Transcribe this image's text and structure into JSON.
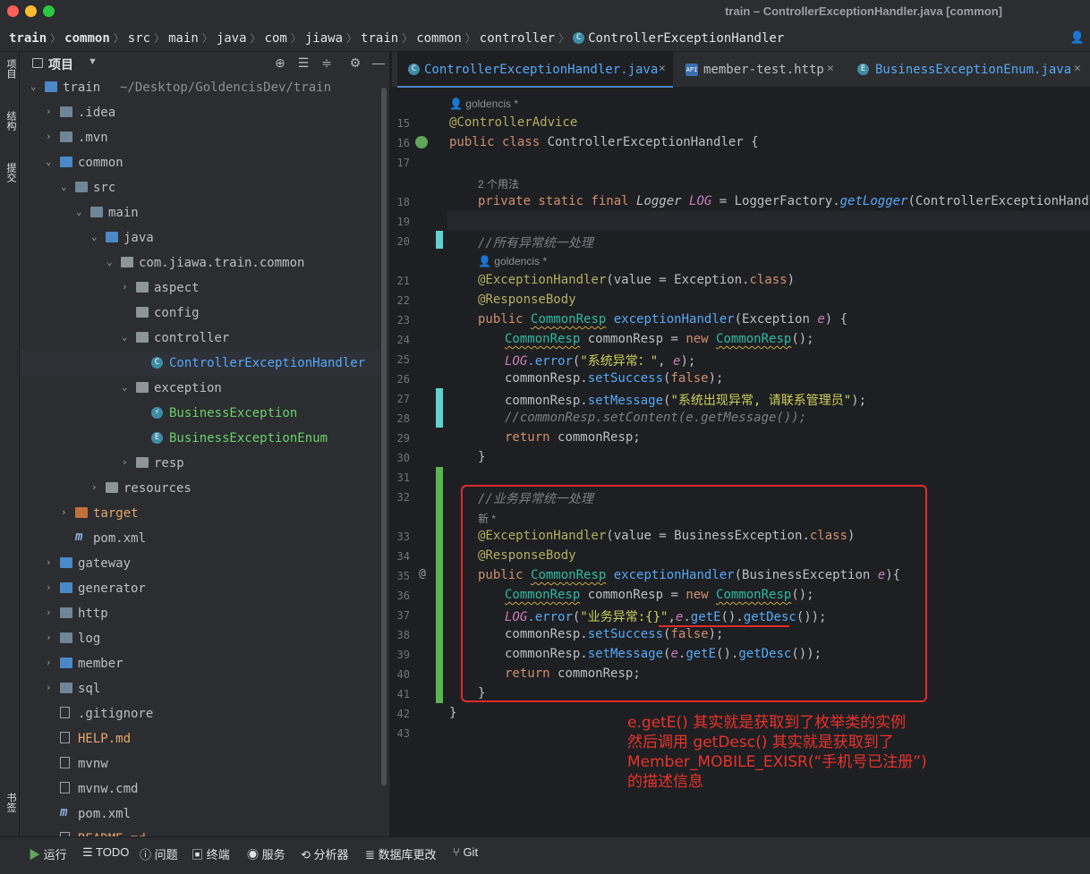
{
  "window": {
    "title": "train – ControllerExceptionHandler.java [common]"
  },
  "breadcrumbs": [
    "train",
    "common",
    "src",
    "main",
    "java",
    "com",
    "jiawa",
    "train",
    "common",
    "controller",
    "ControllerExceptionHandler"
  ],
  "left_tools": {
    "project": "项目",
    "structure": "结构",
    "commit": "提交",
    "bookmarks": "书签"
  },
  "project_panel": {
    "title": "项目",
    "root": "train",
    "root_path": "~/Desktop/GoldencisDev/train",
    "items": [
      {
        "label": ".idea",
        "indent": 1,
        "arrow": "right",
        "icon": "folder"
      },
      {
        "label": ".mvn",
        "indent": 1,
        "arrow": "right",
        "icon": "folder"
      },
      {
        "label": "common",
        "indent": 1,
        "arrow": "down",
        "icon": "module-folder"
      },
      {
        "label": "src",
        "indent": 2,
        "arrow": "down",
        "icon": "folder"
      },
      {
        "label": "main",
        "indent": 3,
        "arrow": "down",
        "icon": "folder"
      },
      {
        "label": "java",
        "indent": 4,
        "arrow": "down",
        "icon": "source-folder"
      },
      {
        "label": "com.jiawa.train.common",
        "indent": 5,
        "arrow": "down",
        "icon": "package"
      },
      {
        "label": "aspect",
        "indent": 6,
        "arrow": "right",
        "icon": "package"
      },
      {
        "label": "config",
        "indent": 6,
        "arrow": "none",
        "icon": "package"
      },
      {
        "label": "controller",
        "indent": 6,
        "arrow": "down",
        "icon": "package"
      },
      {
        "label": "ControllerExceptionHandler",
        "indent": 7,
        "arrow": "none",
        "icon": "class"
      },
      {
        "label": "exception",
        "indent": 6,
        "arrow": "down",
        "icon": "package"
      },
      {
        "label": "BusinessException",
        "indent": 7,
        "arrow": "none",
        "icon": "exception-class"
      },
      {
        "label": "BusinessExceptionEnum",
        "indent": 7,
        "arrow": "none",
        "icon": "enum"
      },
      {
        "label": "resp",
        "indent": 6,
        "arrow": "right",
        "icon": "package"
      },
      {
        "label": "resources",
        "indent": 4,
        "arrow": "right",
        "icon": "resources-folder"
      },
      {
        "label": "target",
        "indent": 2,
        "arrow": "right",
        "icon": "excluded-folder"
      },
      {
        "label": "pom.xml",
        "indent": 2,
        "arrow": "none",
        "icon": "maven"
      },
      {
        "label": "gateway",
        "indent": 1,
        "arrow": "right",
        "icon": "module-folder"
      },
      {
        "label": "generator",
        "indent": 1,
        "arrow": "right",
        "icon": "module-folder"
      },
      {
        "label": "http",
        "indent": 1,
        "arrow": "right",
        "icon": "folder"
      },
      {
        "label": "log",
        "indent": 1,
        "arrow": "right",
        "icon": "folder"
      },
      {
        "label": "member",
        "indent": 1,
        "arrow": "right",
        "icon": "module-folder"
      },
      {
        "label": "sql",
        "indent": 1,
        "arrow": "right",
        "icon": "folder"
      },
      {
        "label": ".gitignore",
        "indent": 1,
        "arrow": "none",
        "icon": "file"
      },
      {
        "label": "HELP.md",
        "indent": 1,
        "arrow": "none",
        "icon": "md"
      },
      {
        "label": "mvnw",
        "indent": 1,
        "arrow": "none",
        "icon": "file"
      },
      {
        "label": "mvnw.cmd",
        "indent": 1,
        "arrow": "none",
        "icon": "file"
      },
      {
        "label": "pom.xml",
        "indent": 1,
        "arrow": "none",
        "icon": "maven"
      },
      {
        "label": "README.md",
        "indent": 1,
        "arrow": "none",
        "icon": "md"
      }
    ]
  },
  "tabs": [
    {
      "label": "ControllerExceptionHandler.java",
      "active": true
    },
    {
      "label": "member-test.http",
      "active": false
    },
    {
      "label": "BusinessExceptionEnum.java",
      "active": false
    }
  ],
  "editor": {
    "author_hint_1": "goldencis *",
    "usages_hint": "2 个用法",
    "author_hint_2": "goldencis *",
    "new_hint": "新 *",
    "line_numbers": [
      "15",
      "16",
      "17",
      "18",
      "19",
      "20",
      "21",
      "22",
      "23",
      "24",
      "25",
      "26",
      "27",
      "28",
      "29",
      "30",
      "31",
      "32",
      "33",
      "34",
      "35",
      "36",
      "37",
      "38",
      "39",
      "40",
      "41",
      "42",
      "43"
    ],
    "code": {
      "l15": "@ControllerAdvice",
      "l16_kw": "public class ",
      "l16_name": "ControllerExceptionHandler {",
      "l18_kw": "private static final ",
      "l18_type": "Logger",
      "l18_var": "LOG",
      "l18_rest": " = LoggerFactory.",
      "l18_fn": "getLogger",
      "l18_arg": "(ControllerExceptionHandler.cla",
      "l20": "//所有异常统一处理",
      "l21_ann": "@ExceptionHandler",
      "l21_rest": "(value = Exception.",
      "l21_kw": "class",
      "l22": "@ResponseBody",
      "l23_kw": "public ",
      "l23_type": "CommonResp",
      "l23_fn": " exceptionHandler",
      "l23_args": "(Exception ",
      "l23_e": "e",
      "l23_end": ") {",
      "l24_type": "CommonResp",
      "l24_mid": " commonResp = ",
      "l24_kw": "new ",
      "l24_type2": "CommonResp",
      "l24_end": "();",
      "l25_log": "LOG",
      "l25_fn": ".error",
      "l25_str": "\"系统异常：\"",
      "l25_e": "e",
      "l26_a": "commonResp.",
      "l26_fn": "setSuccess",
      "l26_kw": "false",
      "l27_a": "commonResp.",
      "l27_fn": "setMessage",
      "l27_str": "\"系统出现异常, 请联系管理员\"",
      "l28": "//commonResp.setContent(e.getMessage());",
      "l29_kw": "return ",
      "l29_rest": "commonResp;",
      "l30": "}",
      "l32": "//业务异常统一处理",
      "l33_ann": "@ExceptionHandler",
      "l33_rest": "(value = BusinessException.",
      "l33_kw": "class",
      "l34": "@ResponseBody",
      "l35_kw": "public ",
      "l35_type": "CommonResp",
      "l35_fn": " exceptionHandler",
      "l35_args": "(BusinessException ",
      "l35_e": "e",
      "l35_end": "){",
      "l36_type": "CommonResp",
      "l36_mid": " commonResp = ",
      "l36_kw": "new ",
      "l36_type2": "CommonResp",
      "l36_end": "();",
      "l37_log": "LOG",
      "l37_fn": ".error",
      "l37_str": "\"业务异常:{}\"",
      "l37_e": "e",
      "l37_get": "getE",
      "l37_desc": "getDesc",
      "l38_a": "commonResp.",
      "l38_fn": "setSuccess",
      "l38_kw": "false",
      "l39_a": "commonResp.",
      "l39_fn": "setMessage",
      "l39_e": "e",
      "l39_get": "getE",
      "l39_desc": "getDesc",
      "l40_kw": "return ",
      "l40_rest": "commonResp;",
      "l41": "}",
      "l42": "}"
    }
  },
  "annotation": {
    "lines": [
      "e.getE() 其实就是获取到了枚举类的实例",
      "然后调用 getDesc() 其实就是获取到了",
      "Member_MOBILE_EXISR(“手机号已注册”)",
      "的描述信息"
    ],
    "color": "#e7332a"
  },
  "bottom_tools": [
    {
      "label": "运行",
      "icon": "run-icon"
    },
    {
      "label": "TODO",
      "icon": "todo-icon"
    },
    {
      "label": "问题",
      "icon": "problems-icon"
    },
    {
      "label": "终端",
      "icon": "terminal-icon"
    },
    {
      "label": "服务",
      "icon": "services-icon"
    },
    {
      "label": "分析器",
      "icon": "profiler-icon"
    },
    {
      "label": "数据库更改",
      "icon": "database-icon"
    },
    {
      "label": "Git",
      "icon": "git-icon"
    }
  ]
}
